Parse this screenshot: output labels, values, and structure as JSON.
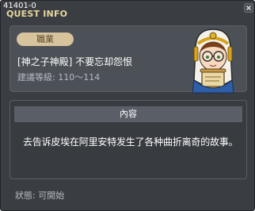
{
  "window": {
    "quest_id": "41401-0",
    "title": "QUEST INFO"
  },
  "quest": {
    "job_badge": "職業",
    "name": "[神之子神殿] 不要忘却怨恨",
    "level": "建議等級: 110～114"
  },
  "content": {
    "header": "內容",
    "text": "去告诉皮埃在阿里安特发生了各种曲折离奇的故事。"
  },
  "footer": {
    "status": "狀態: 可開始"
  },
  "icons": {
    "close": "close-icon",
    "npc": "npc-portrait"
  }
}
